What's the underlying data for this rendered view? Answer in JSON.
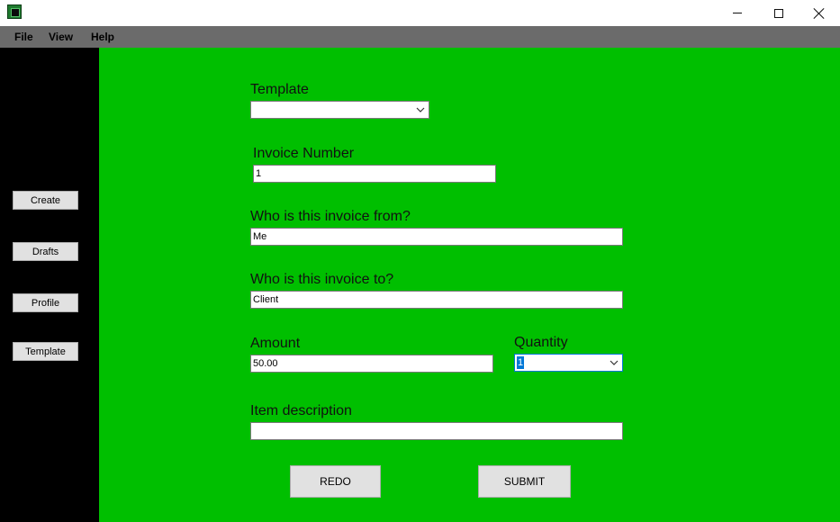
{
  "window": {
    "app_icon": "app-icon",
    "controls": {
      "minimize": "minimize-icon",
      "maximize": "maximize-icon",
      "close": "close-icon"
    }
  },
  "menu": {
    "file": "File",
    "view": "View",
    "help": "Help"
  },
  "sidebar": {
    "items": [
      {
        "label": "Create"
      },
      {
        "label": "Drafts"
      },
      {
        "label": "Profile"
      },
      {
        "label": "Template"
      }
    ]
  },
  "form": {
    "template": {
      "label": "Template",
      "value": ""
    },
    "invoice_number": {
      "label": "Invoice Number",
      "value": "1"
    },
    "from": {
      "label": "Who is this invoice from?",
      "value": "Me"
    },
    "to": {
      "label": "Who is this invoice to?",
      "value": "Client"
    },
    "amount": {
      "label": "Amount",
      "value": "50.00"
    },
    "quantity": {
      "label": "Quantity",
      "value": "1"
    },
    "item_description": {
      "label": "Item description",
      "value": ""
    }
  },
  "actions": {
    "redo": "REDO",
    "submit": "SUBMIT"
  },
  "colors": {
    "main_bg": "#00bf00",
    "sidebar_bg": "#000000",
    "menubar_bg": "#6b6b6b",
    "focus": "#0078d7"
  }
}
